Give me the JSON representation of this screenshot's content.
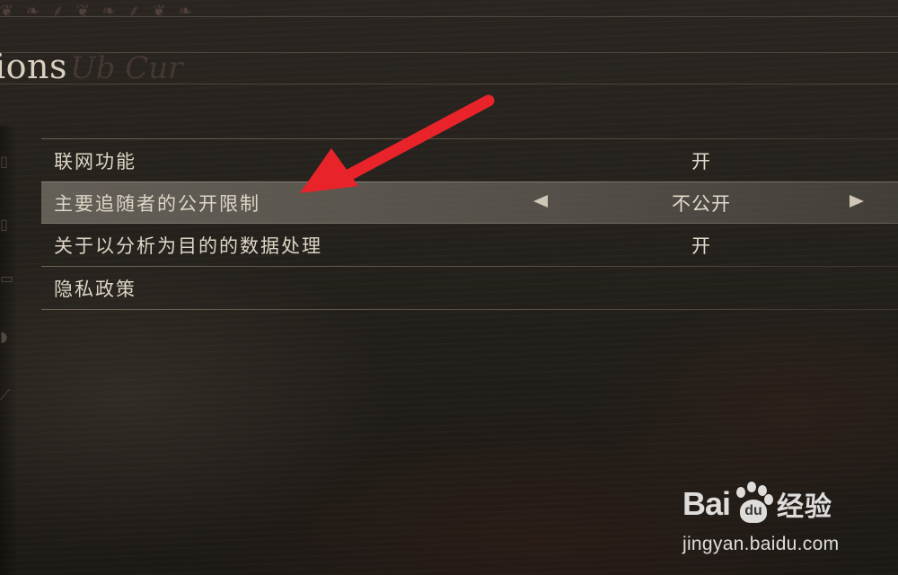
{
  "header": {
    "title": "ions",
    "title_ghost": "Ub Cur"
  },
  "settings": {
    "rows": [
      {
        "label": "联网功能",
        "value": "开"
      },
      {
        "label": "主要追随者的公开限制",
        "value": "不公开"
      },
      {
        "label": "关于以分析为目的的数据处理",
        "value": "开"
      },
      {
        "label": "隐私政策",
        "value": ""
      }
    ],
    "selected_index": 1
  },
  "watermark": {
    "bai": "Bai",
    "du": "du",
    "cn": "经验",
    "url": "jingyan.baidu.com"
  },
  "colors": {
    "annotation_arrow": "#e8242a",
    "selected_row": "#8f8a80",
    "text": "#ddd5c6"
  },
  "icons": {
    "left_arrow": "triangle-left-icon",
    "right_arrow": "triangle-right-icon",
    "annotation": "red-pointer-arrow-icon"
  }
}
